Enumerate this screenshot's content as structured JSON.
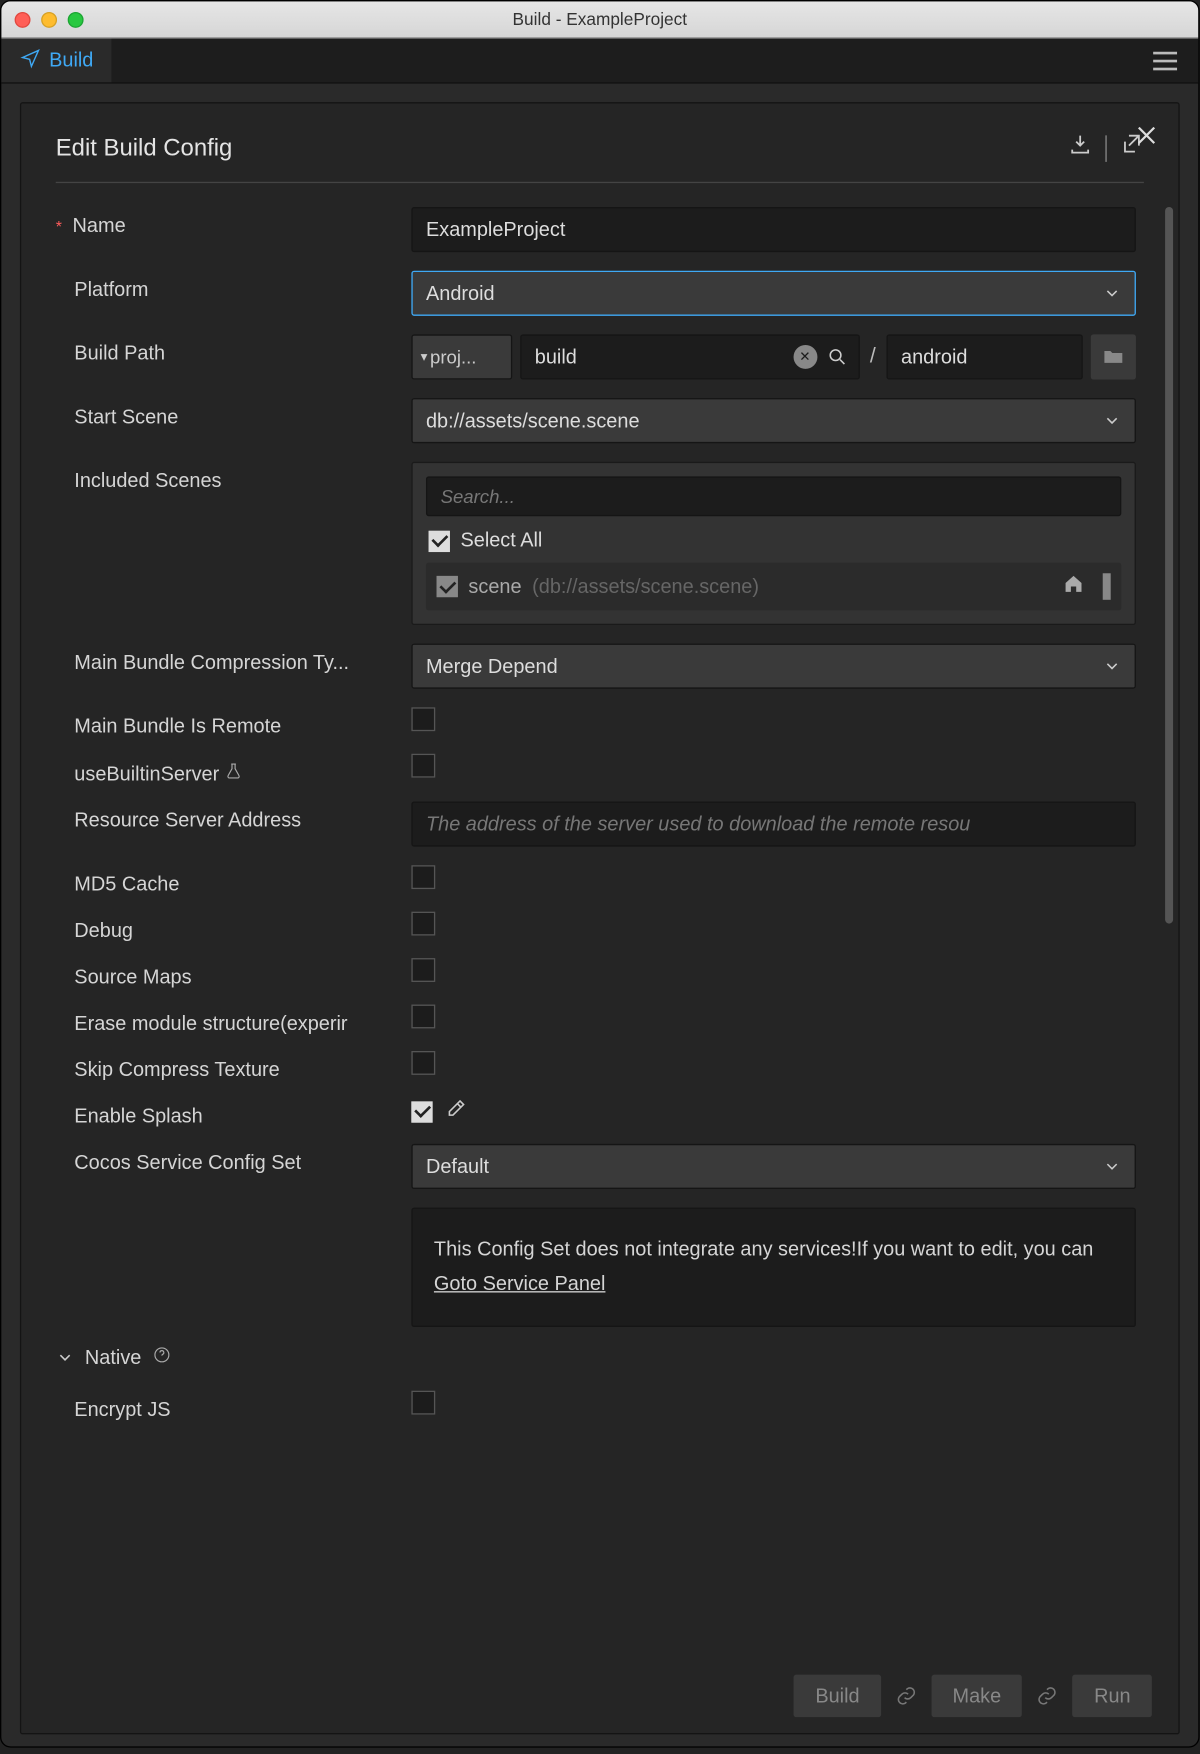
{
  "window": {
    "title": "Build - ExampleProject"
  },
  "tab": {
    "label": "Build"
  },
  "panel": {
    "title": "Edit Build Config"
  },
  "labels": {
    "name": "Name",
    "platform": "Platform",
    "buildPath": "Build Path",
    "startScene": "Start Scene",
    "includedScenes": "Included Scenes",
    "mainBundleCompression": "Main Bundle Compression Ty...",
    "mainBundleIsRemote": "Main Bundle Is Remote",
    "useBuiltinServer": "useBuiltinServer",
    "resourceServerAddress": "Resource Server Address",
    "md5Cache": "MD5 Cache",
    "debug": "Debug",
    "sourceMaps": "Source Maps",
    "eraseModule": "Erase module structure(experir",
    "skipCompress": "Skip Compress Texture",
    "enableSplash": "Enable Splash",
    "cocosServiceConfig": "Cocos Service Config Set",
    "native": "Native",
    "encryptJs": "Encrypt JS"
  },
  "values": {
    "name": "ExampleProject",
    "platform": "Android",
    "pathSeg1": "proj...",
    "pathInput": "build",
    "pathSeg3": "android",
    "startScene": "db://assets/scene.scene",
    "compressionType": "Merge Depend",
    "cocosConfig": "Default"
  },
  "scenes": {
    "searchPlaceholder": "Search...",
    "selectAll": "Select All",
    "item": {
      "name": "scene",
      "path": "(db://assets/scene.scene)"
    }
  },
  "placeholders": {
    "resourceServer": "The address of the server used to download the remote resou"
  },
  "note": {
    "text": "This Config Set does not integrate any services!If you want to edit, you can ",
    "link": "Goto Service Panel"
  },
  "footer": {
    "build": "Build",
    "make": "Make",
    "run": "Run"
  }
}
